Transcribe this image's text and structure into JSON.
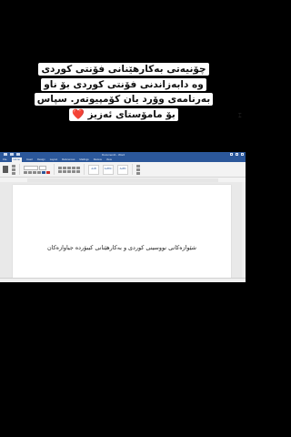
{
  "caption": {
    "lines": [
      "چۆنیەتی بەکارهێنانی فۆنتی کوردی",
      "وە دابەزاندنی فۆنتی کوردی بۆ ناو",
      "بەرنامەی وۆرد یان کۆمپیوتەر. سپاس",
      "بۆ مامۆستای ئەزیز"
    ],
    "heart": "❤️"
  },
  "word": {
    "title": "Document1 - Word",
    "user": "",
    "tabs": [
      "File",
      "Home",
      "Insert",
      "Design",
      "Layout",
      "References",
      "Mailings",
      "Review",
      "View"
    ],
    "style_preview": [
      "AaB",
      "AaBbC",
      "AaBb"
    ],
    "document_text": "شێوازەکانی نووسینی کوردی و بەکارهێنانی کیبۆرده جیاوازەکان",
    "accent_color": "#2b579a"
  }
}
